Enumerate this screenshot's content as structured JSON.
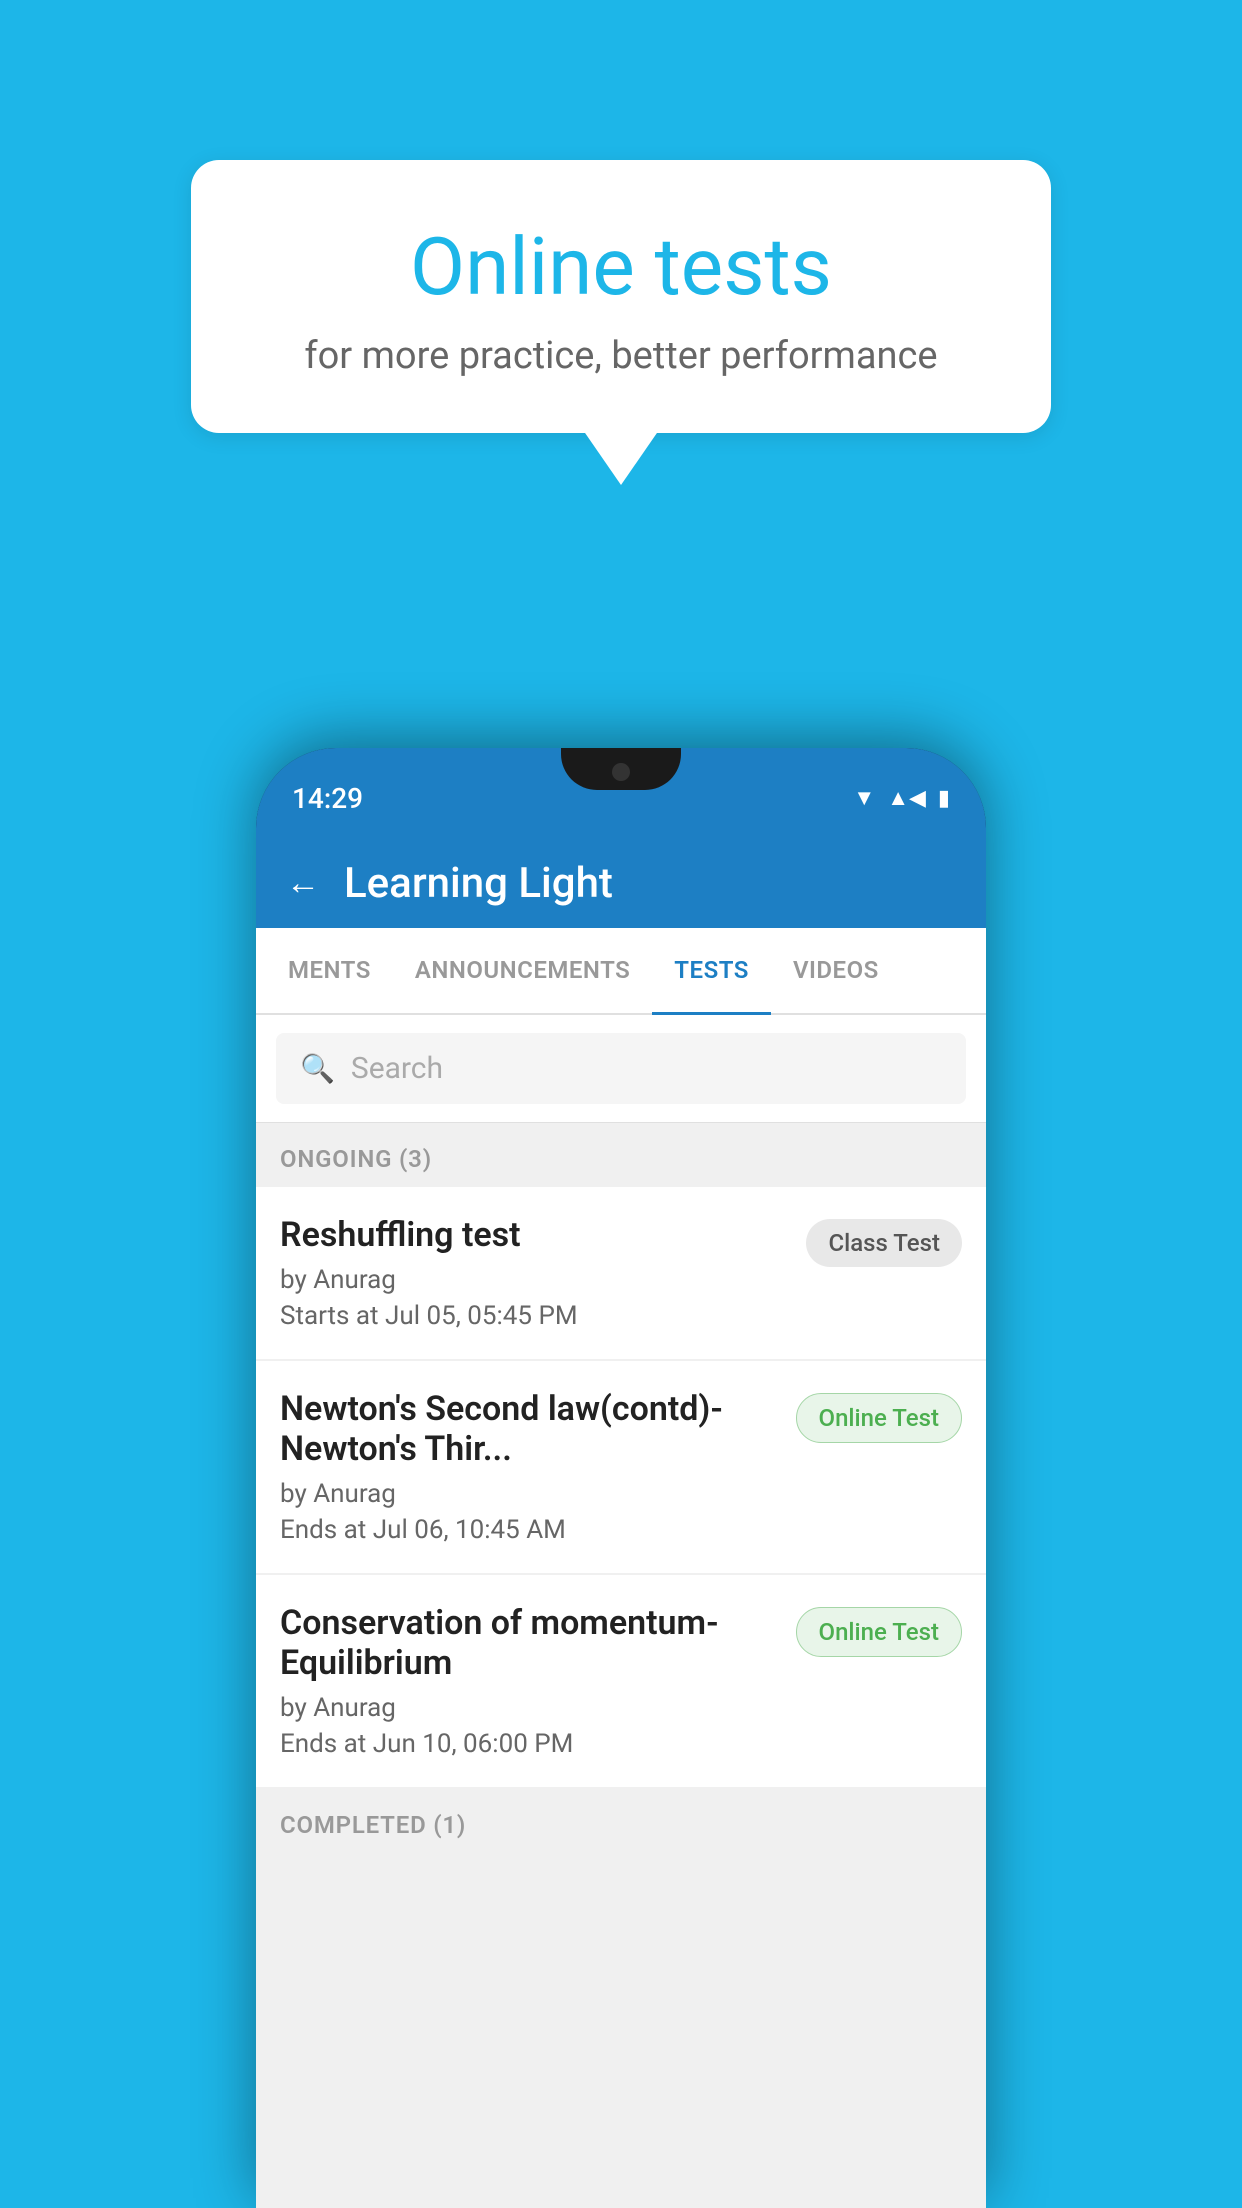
{
  "background": {
    "color": "#1db6e8"
  },
  "speech_bubble": {
    "title": "Online tests",
    "subtitle": "for more practice, better performance"
  },
  "phone": {
    "status_bar": {
      "time": "14:29",
      "icons": [
        "wifi",
        "signal",
        "battery"
      ]
    },
    "app": {
      "title": "Learning Light",
      "back_label": "←"
    },
    "tabs": [
      {
        "label": "MENTS",
        "active": false
      },
      {
        "label": "ANNOUNCEMENTS",
        "active": false
      },
      {
        "label": "TESTS",
        "active": true
      },
      {
        "label": "VIDEOS",
        "active": false
      }
    ],
    "search": {
      "placeholder": "Search",
      "icon": "🔍"
    },
    "sections": [
      {
        "label": "ONGOING (3)",
        "tests": [
          {
            "name": "Reshuffling test",
            "author": "by Anurag",
            "time_label": "Starts at",
            "time": "Jul 05, 05:45 PM",
            "badge": "Class Test",
            "badge_type": "class"
          },
          {
            "name": "Newton's Second law(contd)-Newton's Thir...",
            "author": "by Anurag",
            "time_label": "Ends at",
            "time": "Jul 06, 10:45 AM",
            "badge": "Online Test",
            "badge_type": "online"
          },
          {
            "name": "Conservation of momentum-Equilibrium",
            "author": "by Anurag",
            "time_label": "Ends at",
            "time": "Jun 10, 06:00 PM",
            "badge": "Online Test",
            "badge_type": "online"
          }
        ]
      },
      {
        "label": "COMPLETED (1)",
        "tests": []
      }
    ]
  }
}
